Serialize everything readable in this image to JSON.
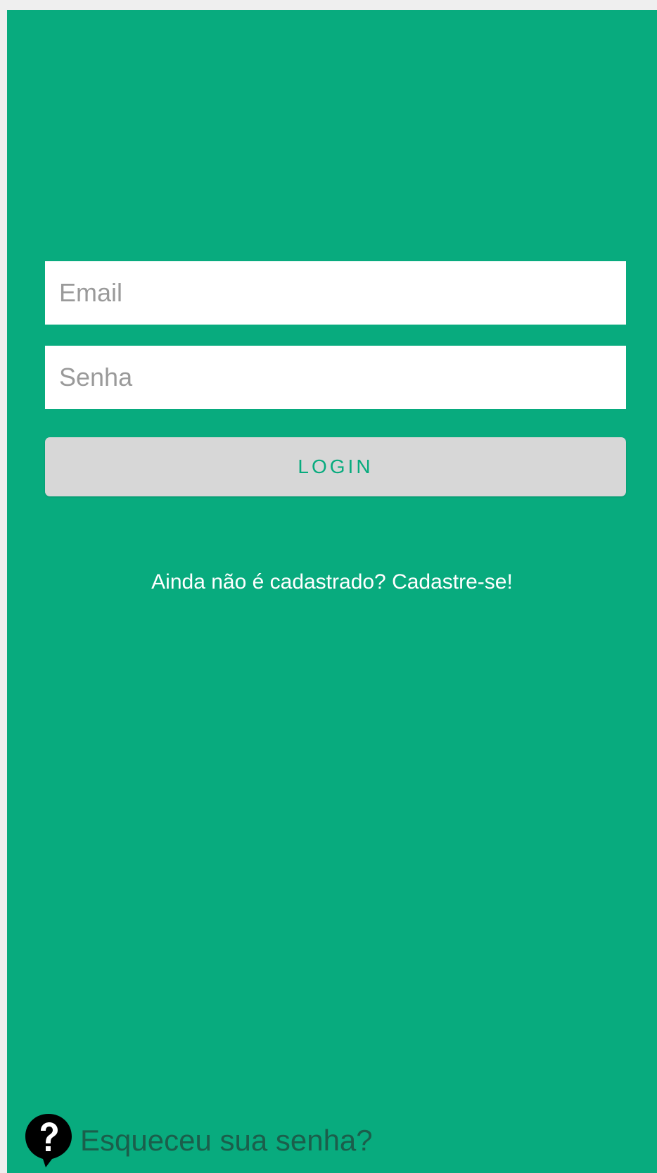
{
  "login": {
    "email_placeholder": "Email",
    "password_placeholder": "Senha",
    "login_button_label": "LOGIN",
    "signup_link_text": "Ainda não é cadastrado? Cadastre-se!"
  },
  "footer": {
    "forgot_password_text": "Esqueceu sua senha?",
    "forgot_icon": "help-bubble-icon"
  },
  "colors": {
    "background": "#08ab7e",
    "input_background": "#ffffff",
    "button_background": "#d7d7d7",
    "button_text": "#08ab7e",
    "forgot_text": "#1b5e4b"
  }
}
